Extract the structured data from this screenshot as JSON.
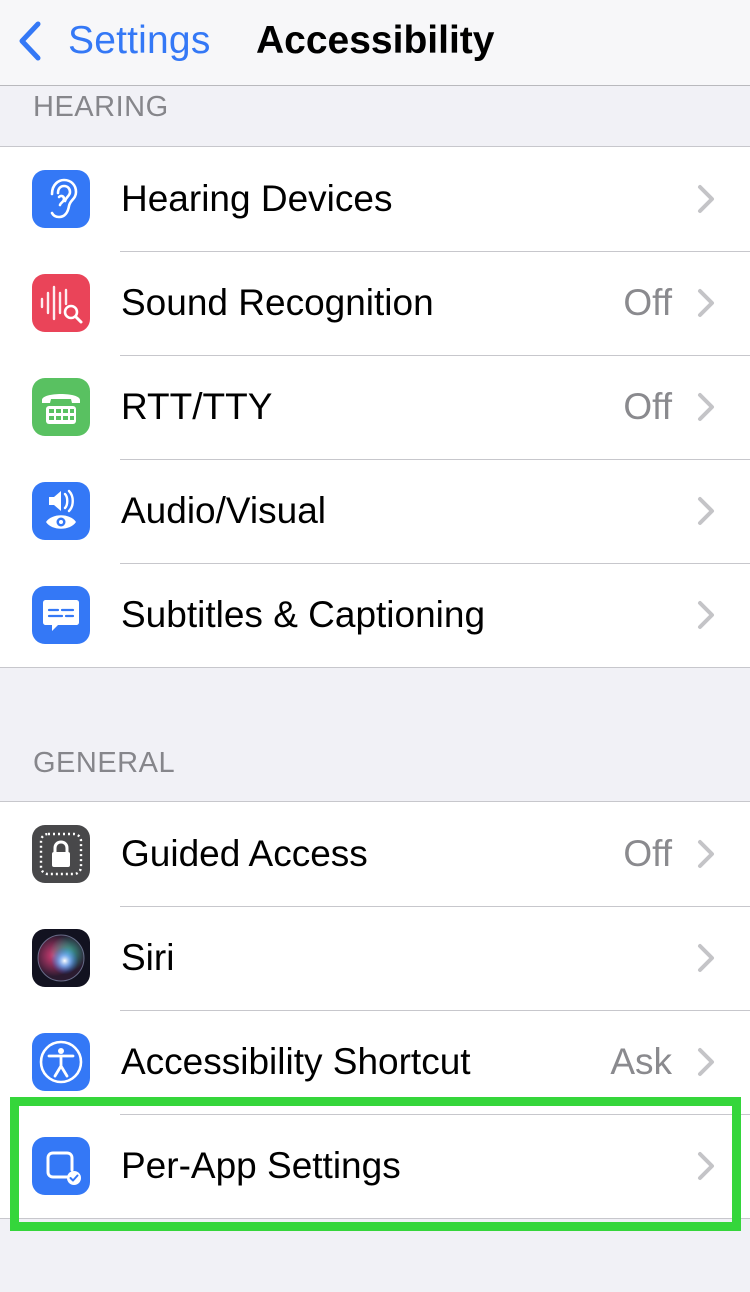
{
  "navbar": {
    "back_label": "Settings",
    "title": "Accessibility",
    "accent_color": "#3478f6"
  },
  "sections": [
    {
      "header": "HEARING",
      "rows": [
        {
          "label": "Hearing Devices",
          "value": null,
          "icon": "ear-icon",
          "icon_color": "#3478f6"
        },
        {
          "label": "Sound Recognition",
          "value": "Off",
          "icon": "waveform-search-icon",
          "icon_color": "#ea4459"
        },
        {
          "label": "RTT/TTY",
          "value": "Off",
          "icon": "tty-phone-icon",
          "icon_color": "#59c161"
        },
        {
          "label": "Audio/Visual",
          "value": null,
          "icon": "speaker-eye-icon",
          "icon_color": "#3478f6"
        },
        {
          "label": "Subtitles & Captioning",
          "value": null,
          "icon": "caption-bubble-icon",
          "icon_color": "#3478f6"
        }
      ]
    },
    {
      "header": "GENERAL",
      "rows": [
        {
          "label": "Guided Access",
          "value": "Off",
          "icon": "guided-access-lock-icon",
          "icon_color": "#48484a"
        },
        {
          "label": "Siri",
          "value": null,
          "icon": "siri-icon",
          "icon_color": "#1b1b2a"
        },
        {
          "label": "Accessibility Shortcut",
          "value": "Ask",
          "icon": "accessibility-person-icon",
          "icon_color": "#3478f6"
        },
        {
          "label": "Per-App Settings",
          "value": null,
          "icon": "per-app-settings-icon",
          "icon_color": "#3478f6",
          "highlighted": true
        }
      ]
    }
  ],
  "highlight_color": "#35d63b"
}
